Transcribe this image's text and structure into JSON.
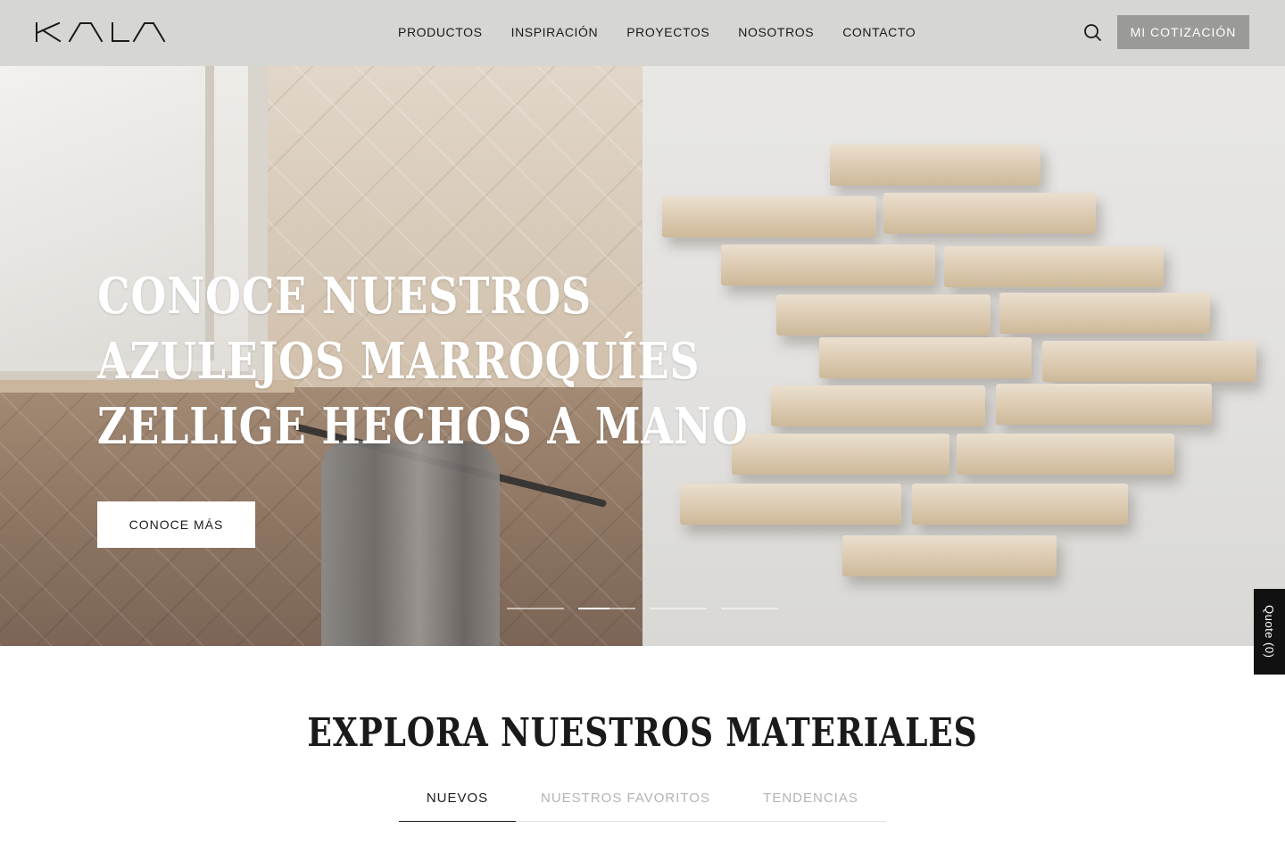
{
  "header": {
    "logo_text": "KALA",
    "nav": [
      "PRODUCTOS",
      "INSPIRACIÓN",
      "PROYECTOS",
      "NOSOTROS",
      "CONTACTO"
    ],
    "search_icon": "search-icon",
    "quote_button": "MI COTIZACIÓN"
  },
  "hero": {
    "title_lines": [
      "CONOCE NUESTROS",
      "AZULEJOS MARROQUÍES",
      "ZELLIGE HECHOS A MANO"
    ],
    "cta": "CONOCE MÁS",
    "slides_count": 4,
    "active_slide_index": 1,
    "active_slide_progress": 0.55
  },
  "quote_tab": "Quote (0)",
  "materials": {
    "title": "EXPLORA NUESTROS MATERIALES",
    "tabs": [
      "NUEVOS",
      "NUESTROS FAVORITOS",
      "TENDENCIAS"
    ],
    "active_tab_index": 0
  },
  "colors": {
    "header_bg": "#d6d6d2",
    "quote_button_bg": "#9a9a96",
    "text_dark": "#1a1a1a",
    "tab_inactive": "#b3b3b3"
  }
}
